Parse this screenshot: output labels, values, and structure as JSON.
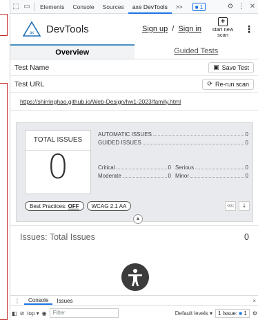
{
  "devtools_bar": {
    "tabs": [
      "Elements",
      "Console",
      "Sources",
      "axe DevTools"
    ],
    "more": ">>",
    "badge": "1"
  },
  "axe": {
    "brand": "DevTools",
    "sign_up": "Sign up",
    "slash": "/",
    "sign_in": "Sign in",
    "start_scan": "start new scan"
  },
  "tabs": {
    "overview": "Overview",
    "guided": "Guided Tests"
  },
  "test_name": {
    "label": "Test Name",
    "save": "Save Test"
  },
  "test_url": {
    "label": "Test URL",
    "rerun": "Re-run scan",
    "url": "https://shirringhao.github.io/Web-Design/hw1-2023/family.html"
  },
  "summary": {
    "total_label": "TOTAL ISSUES",
    "total": "0",
    "automatic_label": "AUTOMATIC ISSUES",
    "automatic": "0",
    "guided_label": "GUIDED ISSUES",
    "guided": "0",
    "critical_label": "Critical",
    "critical": "0",
    "serious_label": "Serious",
    "serious": "0",
    "moderate_label": "Moderate",
    "moderate": "0",
    "minor_label": "Minor",
    "minor": "0",
    "best_practices_label": "Best Practices:",
    "best_practices_value": "OFF",
    "wcag": "WCAG 2.1 AA"
  },
  "issues": {
    "title": "Issues: Total Issues",
    "count": "0"
  },
  "drawer": {
    "console": "Console",
    "issues": "Issues",
    "close": "×"
  },
  "console_bar": {
    "context": "top ▾",
    "filter_placeholder": "Filter",
    "levels": "Default levels ▾",
    "issues_label": "1 Issue:",
    "issues_count": "1"
  }
}
